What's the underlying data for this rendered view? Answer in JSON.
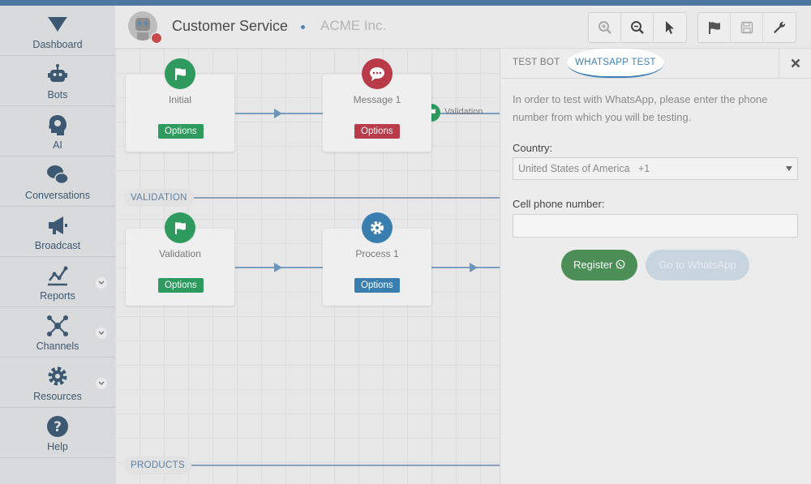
{
  "sidebar": {
    "items": [
      {
        "label": "Dashboard",
        "icon": "dashboard-logo-icon"
      },
      {
        "label": "Bots",
        "icon": "robot-icon"
      },
      {
        "label": "AI",
        "icon": "brain-head-icon"
      },
      {
        "label": "Conversations",
        "icon": "chat-bubbles-icon"
      },
      {
        "label": "Broadcast",
        "icon": "megaphone-icon"
      },
      {
        "label": "Reports",
        "icon": "line-chart-icon",
        "expandable": true
      },
      {
        "label": "Channels",
        "icon": "network-icon",
        "expandable": true
      },
      {
        "label": "Resources",
        "icon": "gear-icon",
        "expandable": true
      },
      {
        "label": "Help",
        "icon": "question-icon"
      }
    ]
  },
  "header": {
    "bot_name": "Customer Service",
    "company": "ACME Inc.",
    "toolbar": [
      "zoom-in-icon",
      "zoom-out-icon",
      "pointer-icon",
      "flag-icon",
      "save-icon",
      "wrench-icon"
    ]
  },
  "canvas": {
    "nodes": {
      "initial": {
        "title": "Initial",
        "button": "Options",
        "color": "#2e9a5e"
      },
      "message1": {
        "title": "Message 1",
        "button": "Options",
        "color": "#b93a48"
      },
      "validation": {
        "title": "Validation",
        "button": "Options",
        "color": "#2e9a5e"
      },
      "process1": {
        "title": "Process 1",
        "button": "Options",
        "color": "#3a7eb0"
      }
    },
    "link_label": "Validation",
    "sections": [
      "VALIDATION",
      "PRODUCTS"
    ]
  },
  "panel": {
    "tabs": {
      "test_bot": "TEST BOT",
      "whatsapp_test": "WHATSAPP TEST"
    },
    "intro": "In order to test with WhatsApp, please enter the phone number from which you will be testing.",
    "country_label": "Country:",
    "country_value": "United States of America   +1",
    "phone_label": "Cell phone number:",
    "phone_value": "",
    "register_label": "Register",
    "go_whatsapp_label": "Go to WhatsApp",
    "colors": {
      "accent": "#3f7fb6",
      "register": "#4b8f57",
      "disabled": "#c8d4de"
    }
  }
}
